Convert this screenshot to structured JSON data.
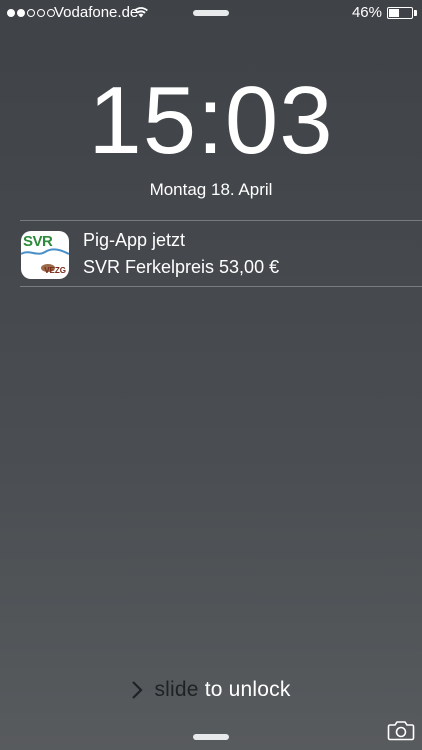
{
  "status_bar": {
    "signal_bars_filled": 2,
    "signal_bars_total": 5,
    "carrier": "Vodafone.de",
    "wifi_icon": "wifi-icon",
    "battery_percent": "46%",
    "battery_level": 0.46
  },
  "lockscreen": {
    "time": "15:03",
    "date": "Montag 18. April"
  },
  "notification": {
    "app_icon": "svr-app-icon",
    "icon_text": "SVR",
    "icon_subtext": "VEZG",
    "title": "Pig-App jetzt",
    "body": "SVR Ferkelpreis 53,00 €"
  },
  "unlock": {
    "text_dark": "slide",
    "text_light": "to unlock",
    "chevron_icon": "chevron-right-icon"
  },
  "camera_icon": "camera-icon"
}
